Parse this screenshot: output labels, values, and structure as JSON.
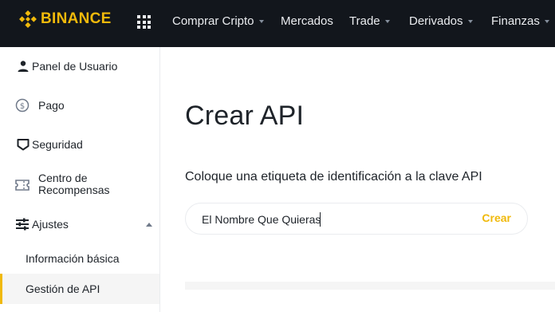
{
  "brand": {
    "name": "BINANCE",
    "color": "#f0b90b"
  },
  "topnav": {
    "apps_icon": "grid-icon",
    "items": [
      {
        "label": "Comprar Cripto",
        "caret": true
      },
      {
        "label": "Mercados",
        "caret": false
      },
      {
        "label": "Trade",
        "caret": true
      },
      {
        "label": "Derivados",
        "caret": true
      },
      {
        "label": "Finanzas",
        "caret": true
      }
    ]
  },
  "sidebar": {
    "items": [
      {
        "label": "Panel de Usuario",
        "icon": "user-icon"
      },
      {
        "label": "Pago",
        "icon": "dollar-circle-icon"
      },
      {
        "label": "Seguridad",
        "icon": "shield-icon"
      },
      {
        "label": "Centro de\nRecompensas",
        "icon": "ticket-icon"
      },
      {
        "label": "Ajustes",
        "icon": "sliders-icon",
        "expanded": true
      }
    ],
    "subitems": [
      {
        "label": "Información básica",
        "active": false
      },
      {
        "label": "Gestión de API",
        "active": true
      }
    ]
  },
  "main": {
    "title": "Crear API",
    "description": "Coloque una etiqueta de identificación a la clave API",
    "input_value": "El Nombre Que Quieras",
    "create_label": "Crear"
  },
  "colors": {
    "accent": "#f0b90b",
    "topbar_bg": "#12161c",
    "text": "#1e2329"
  }
}
